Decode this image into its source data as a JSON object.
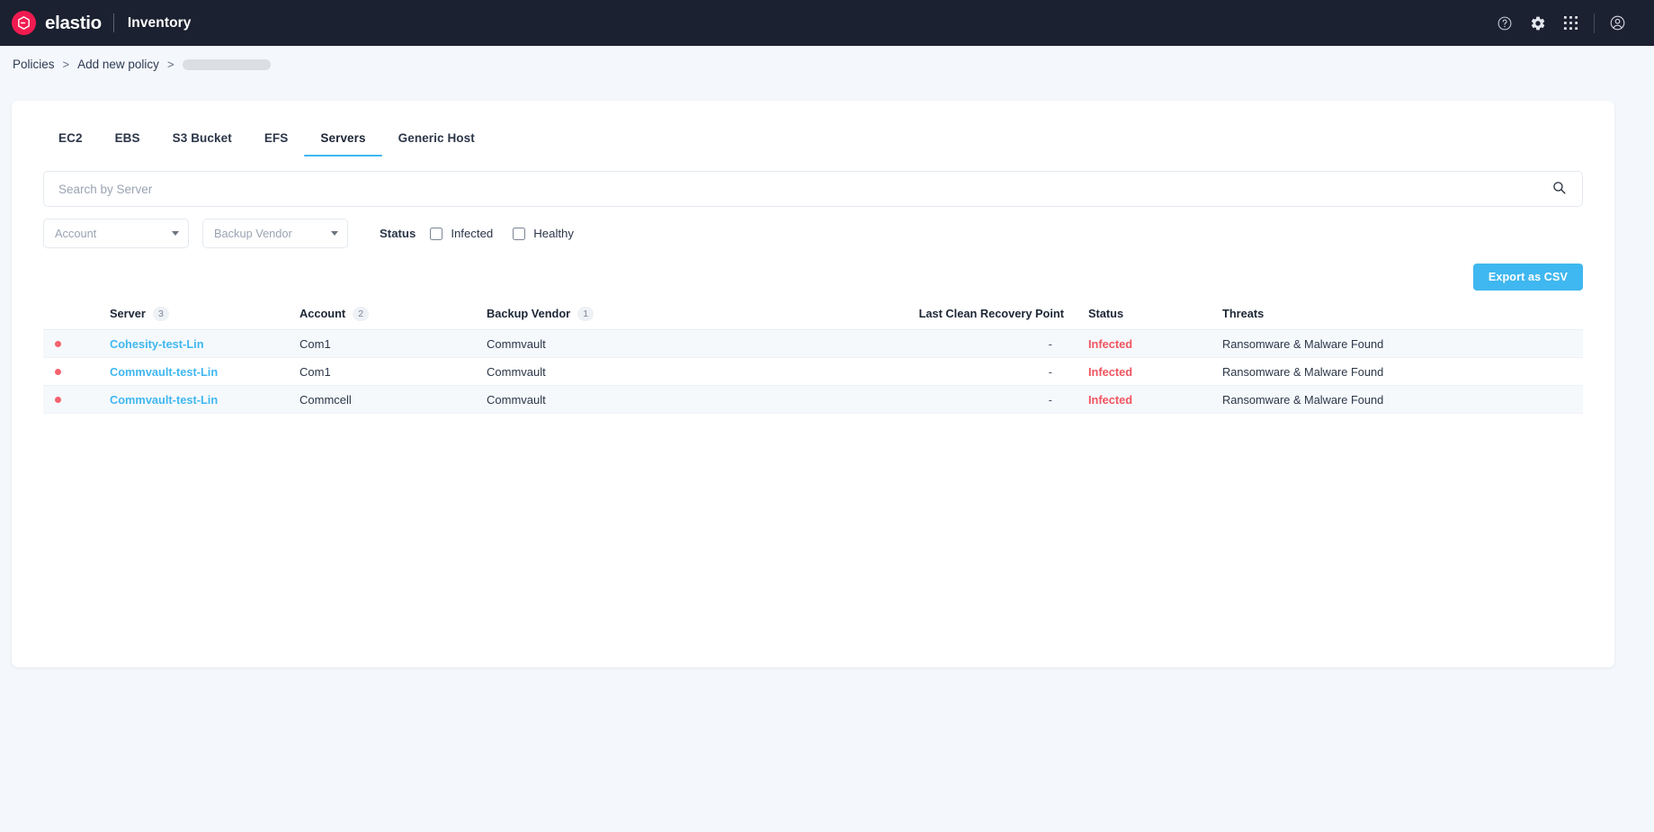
{
  "topbar": {
    "logo_text": "elastio",
    "app_title": "Inventory",
    "logo_color": "#f01b50",
    "background": "#1b2130",
    "actions": [
      {
        "name": "help-icon",
        "label": "Help"
      },
      {
        "name": "gear-icon",
        "label": "Settings"
      },
      {
        "name": "apps-grid-icon",
        "label": "Apps"
      },
      {
        "name": "account-icon",
        "label": "Account"
      }
    ]
  },
  "breadcrumb": {
    "items": [
      {
        "label": "Policies",
        "link": true
      },
      {
        "label": "Add new policy",
        "link": true
      }
    ],
    "separator": ">",
    "loading_placeholder": true
  },
  "tabs": [
    {
      "label": "EC2",
      "active": false
    },
    {
      "label": "EBS",
      "active": false
    },
    {
      "label": "S3 Bucket",
      "active": false
    },
    {
      "label": "EFS",
      "active": false
    },
    {
      "label": "Servers",
      "active": true
    },
    {
      "label": "Generic Host",
      "active": false
    }
  ],
  "search": {
    "placeholder": "Search by Server",
    "value": "",
    "icon": "search-icon"
  },
  "filters": {
    "account_select": {
      "placeholder": "Account",
      "value": ""
    },
    "vendor_select": {
      "placeholder": "Backup Vendor",
      "value": ""
    },
    "status_label": "Status",
    "checkboxes": [
      {
        "label": "Infected",
        "checked": false
      },
      {
        "label": "Healthy",
        "checked": false
      }
    ]
  },
  "toolbar": {
    "export_label": "Export as CSV",
    "export_color": "#3fb7f0"
  },
  "table": {
    "columns": [
      {
        "label": "Server",
        "count": "3"
      },
      {
        "label": "Account",
        "count": "2"
      },
      {
        "label": "Backup Vendor",
        "count": "1"
      },
      {
        "label": "Last Clean Recovery Point",
        "count": ""
      },
      {
        "label": "Status",
        "count": ""
      },
      {
        "label": "Threats",
        "count": ""
      }
    ],
    "rows": [
      {
        "indicator": "infected",
        "server": "Cohesity-test-Lin",
        "account": "Com1",
        "vendor": "Commvault",
        "last_clean_recovery_point": "-",
        "status": "Infected",
        "threats": "Ransomware & Malware Found"
      },
      {
        "indicator": "infected",
        "server": "Commvault-test-Lin",
        "account": "Com1",
        "vendor": "Commvault",
        "last_clean_recovery_point": "-",
        "status": "Infected",
        "threats": "Ransomware & Malware Found"
      },
      {
        "indicator": "infected",
        "server": "Commvault-test-Lin",
        "account": "Commcell",
        "vendor": "Commvault",
        "last_clean_recovery_point": "-",
        "status": "Infected",
        "threats": "Ransomware & Malware Found"
      }
    ]
  },
  "colors": {
    "accent": "#3fb7f0",
    "danger": "#f0545f",
    "brand": "#f01b50",
    "page_bg": "#f4f7fb",
    "row_alt": "#f6f9fc"
  }
}
